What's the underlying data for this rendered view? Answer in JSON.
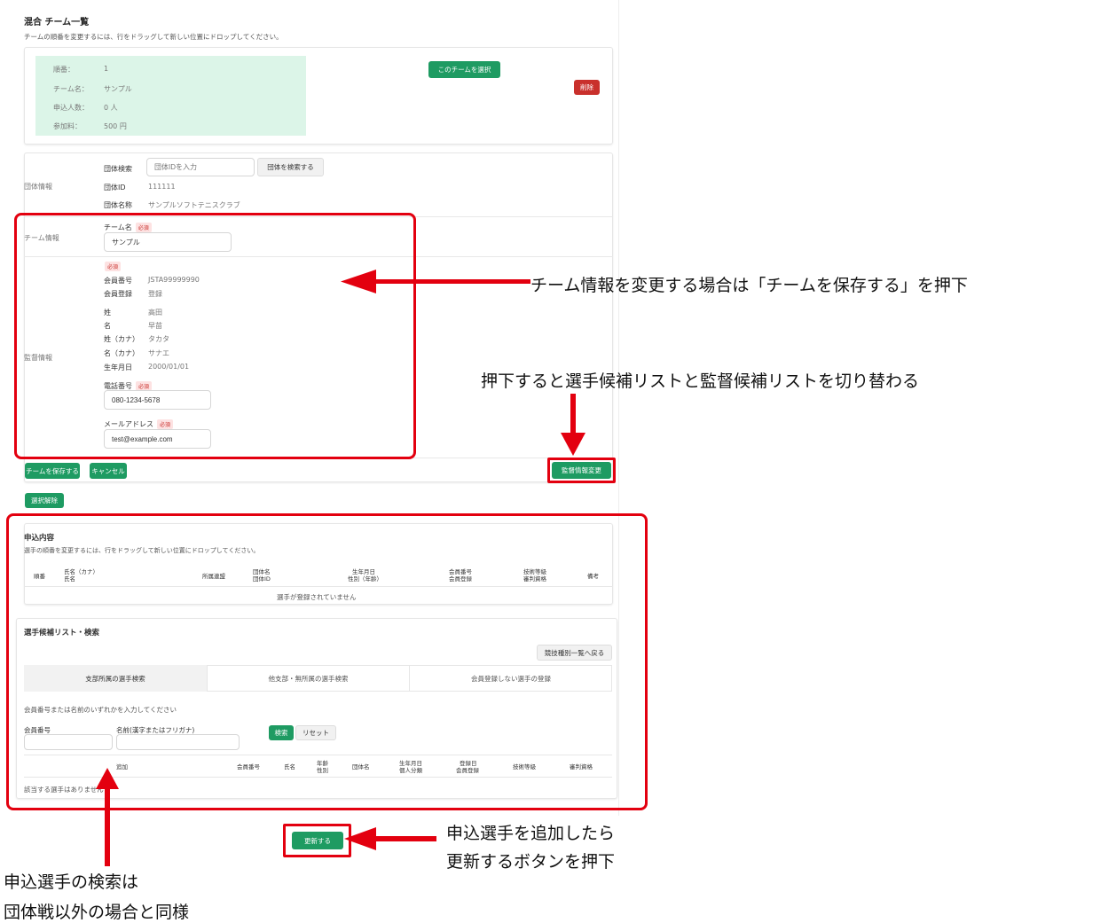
{
  "header": {
    "title": "混合 チーム一覧",
    "subtitle": "チームの順番を変更するには、行をドラッグして新しい位置にドロップしてください。"
  },
  "team_summary": {
    "rows": [
      {
        "label": "順番：",
        "value": "1"
      },
      {
        "label": "チーム名：",
        "value": "サンプル"
      },
      {
        "label": "申込人数：",
        "value": "0 人"
      },
      {
        "label": "参加料：",
        "value": "500 円"
      }
    ],
    "select_button": "このチームを選択",
    "delete_button": "削除"
  },
  "group_info": {
    "section_label": "団体情報",
    "search_label": "団体検索",
    "search_placeholder": "団体IDを入力",
    "search_button": "団体を検索する",
    "id_label": "団体ID",
    "id_value": "111111",
    "name_label": "団体名称",
    "name_value": "サンプルソフトテニスクラブ"
  },
  "team_info": {
    "section_label": "チーム情報",
    "team_name_label": "チーム名",
    "required": "必須",
    "team_name_value": "サンプル"
  },
  "coach_info": {
    "section_label": "監督情報",
    "required": "必須",
    "member_no_label": "会員番号",
    "member_no_value": "JSTA99999990",
    "member_reg_label": "会員登録",
    "member_reg_value": "登録",
    "last_name_label": "姓",
    "last_name_value": "高田",
    "first_name_label": "名",
    "first_name_value": "早苗",
    "last_kana_label": "姓（カナ）",
    "last_kana_value": "タカタ",
    "first_kana_label": "名（カナ）",
    "first_kana_value": "サナエ",
    "birth_label": "生年月日",
    "birth_value": "2000/01/01",
    "phone_label": "電話番号",
    "phone_value": "080-1234-5678",
    "email_label": "メールアドレス",
    "email_value": "test@example.com"
  },
  "actions": {
    "save_team": "チームを保存する",
    "cancel": "キャンセル",
    "coach_change": "監督情報変更",
    "deselect": "選択解除",
    "update": "更新する"
  },
  "application": {
    "title": "申込内容",
    "subtitle": "選手の順番を変更するには、行をドラッグして新しい位置にドロップしてください。",
    "headers": {
      "order": "順番",
      "name_kana": "氏名（カナ）",
      "name": "氏名",
      "branch": "所属連盟",
      "group_name": "団体名",
      "group_id": "団体ID",
      "birth": "生年月日",
      "gender_age": "性別（年齢）",
      "member_no": "会員番号",
      "member_reg": "会員登録",
      "skill": "技術等級",
      "referee": "審判資格",
      "note": "備考"
    },
    "empty": "選手が登録されていません"
  },
  "candidates": {
    "title": "選手候補リスト・検索",
    "back_button": "競技種別一覧へ戻る",
    "tabs": [
      "支部所属の選手検索",
      "他支部・無所属の選手検索",
      "会員登録しない選手の登録"
    ],
    "hint": "会員番号または名前のいずれかを入力してください",
    "member_no_label": "会員番号",
    "name_label": "名前(漢字またはフリガナ)",
    "search_button": "検索",
    "reset_button": "リセット",
    "headers": {
      "add": "追加",
      "member_no": "会員番号",
      "name": "氏名",
      "age": "年齢",
      "gender": "性別",
      "group": "団体名",
      "birth": "生年月日",
      "category": "個人分類",
      "reg_date": "登録日",
      "member_reg": "会員登録",
      "skill": "技術等級",
      "referee": "審判資格"
    },
    "empty": "該当する選手はありません"
  },
  "annotations": {
    "team_info": "チーム情報を変更する場合は「チームを保存する」を押下",
    "toggle": "押下すると選手候補リストと監督候補リストを切り替わる",
    "update_line1": "申込選手を追加したら",
    "update_line2": "更新するボタンを押下",
    "search_line1": "申込選手の検索は",
    "search_line2": "団体戦以外の場合と同様"
  },
  "colors": {
    "accent_green": "#1e9b62",
    "danger_red": "#c9302c",
    "annotation_red": "#e3000f",
    "summary_bg": "#dcf5e8"
  }
}
